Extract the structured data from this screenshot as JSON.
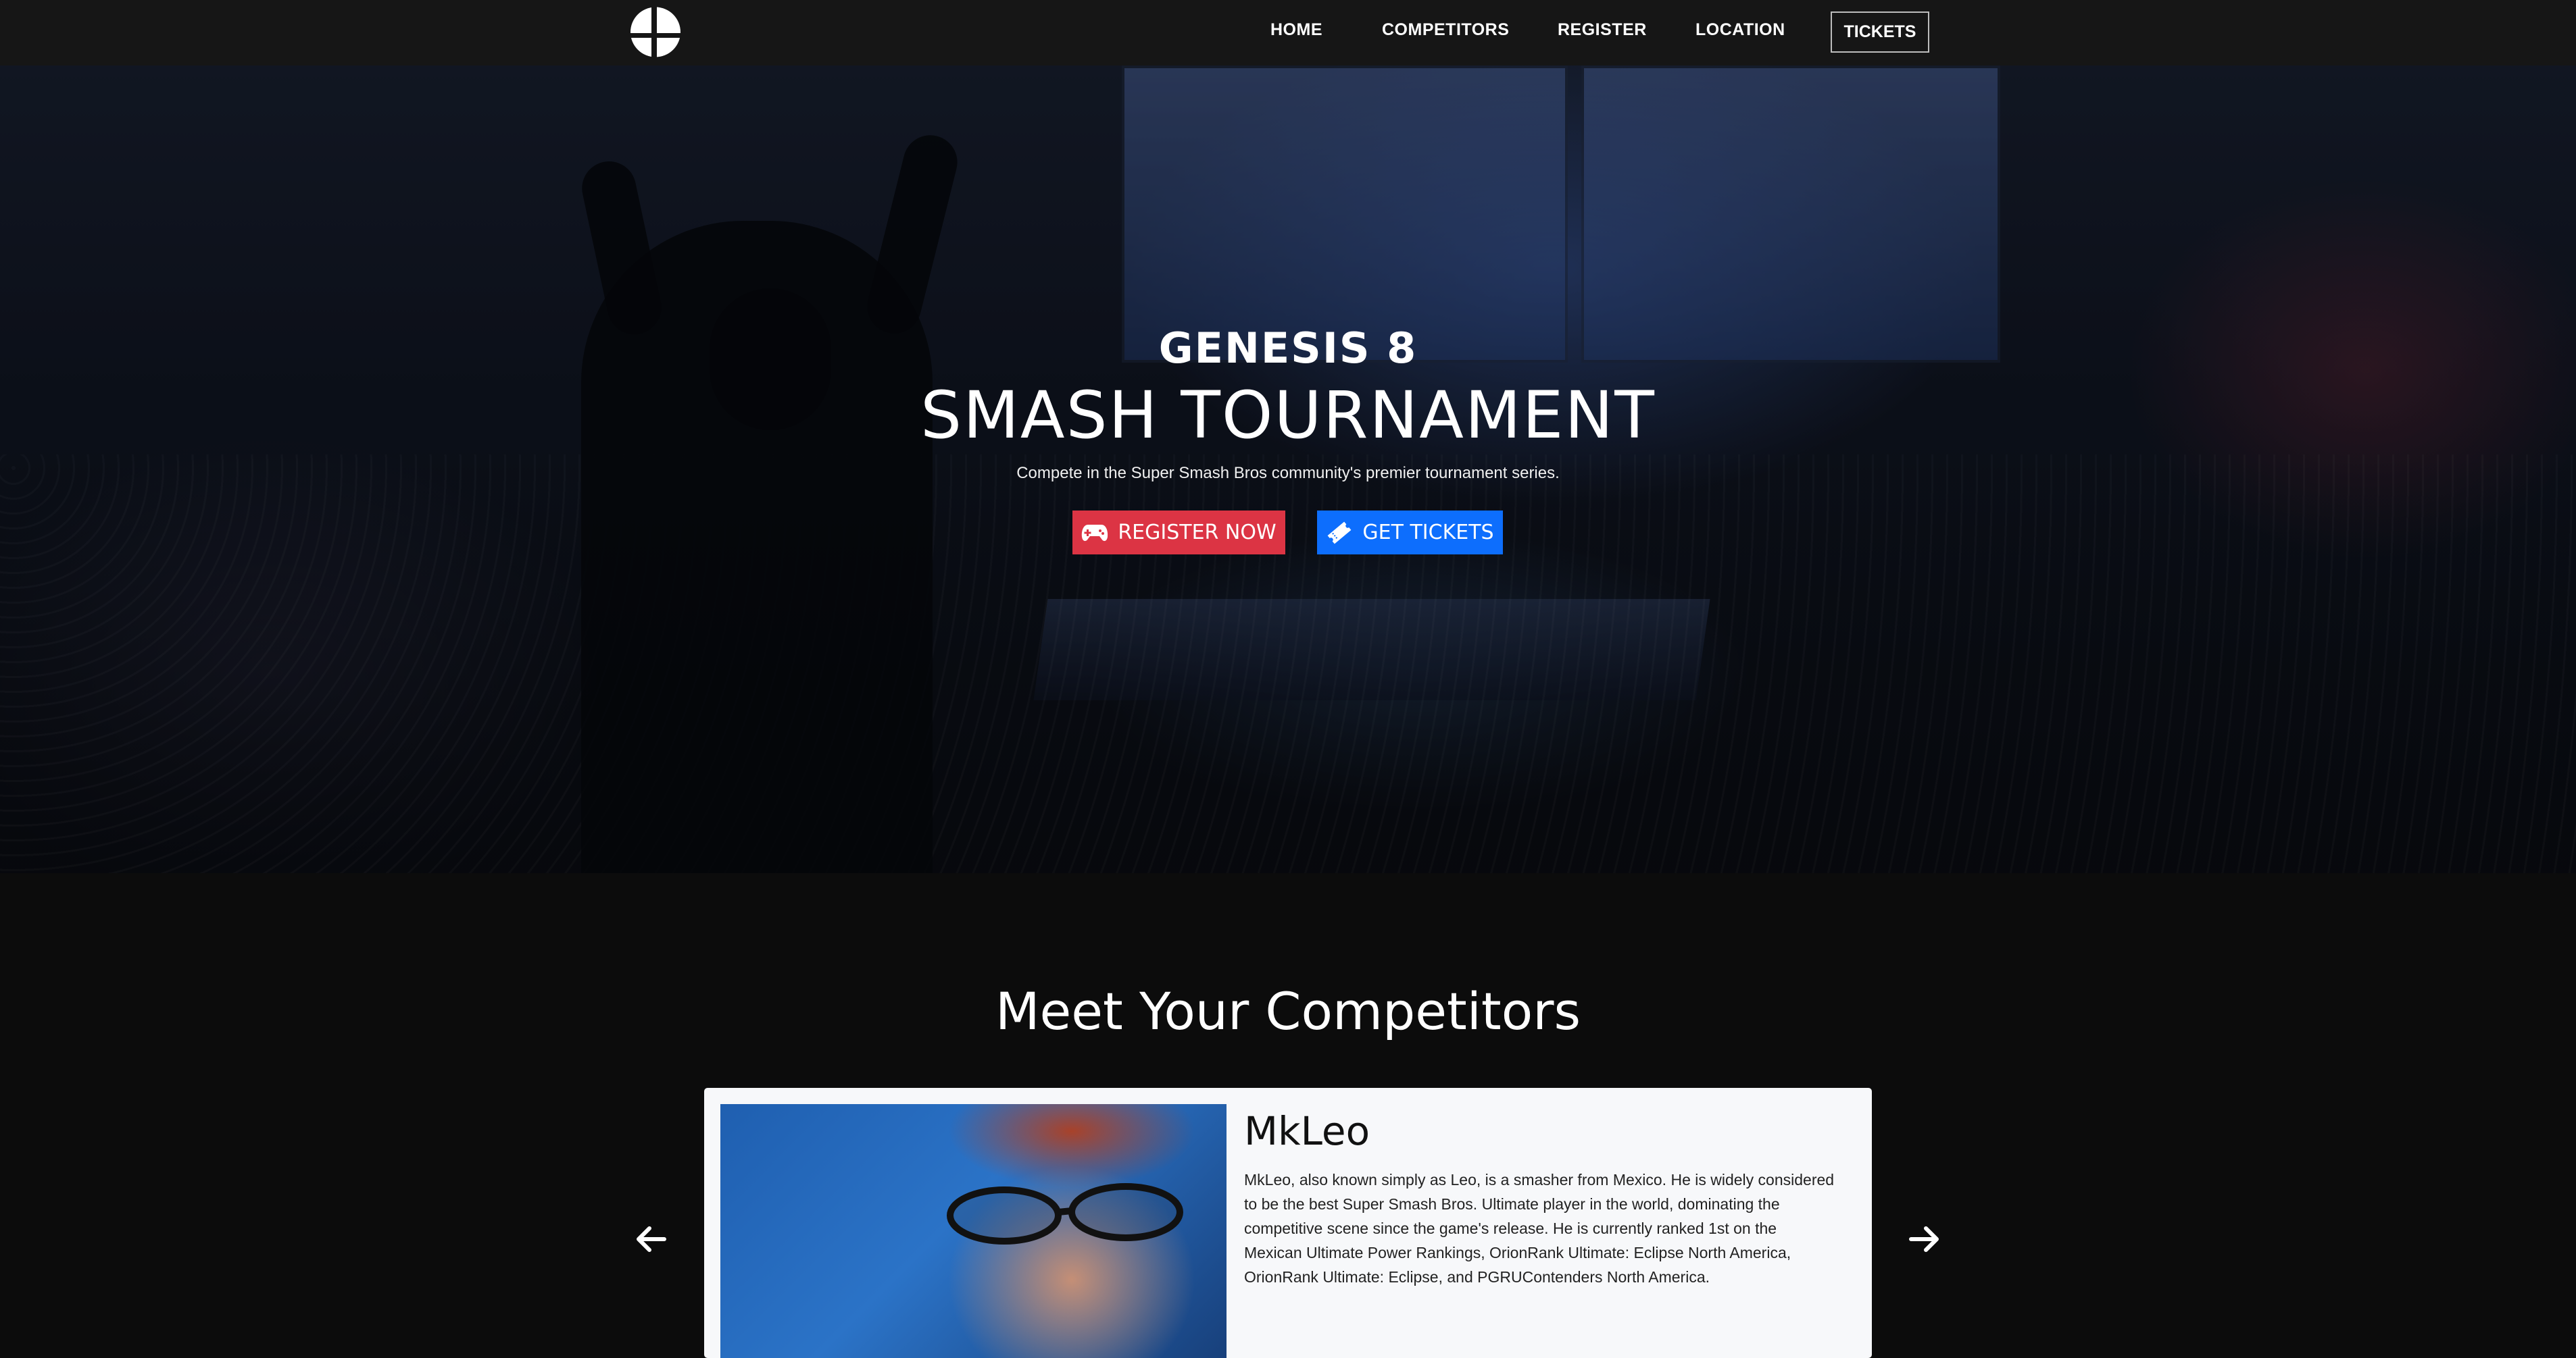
{
  "nav": {
    "links": [
      "HOME",
      "COMPETITORS",
      "REGISTER",
      "LOCATION"
    ],
    "tickets": "TICKETS",
    "logo_icon": "smash-ball-logo-icon"
  },
  "hero": {
    "subtitle": "GENESIS 8",
    "title": "SMASH TOURNAMENT",
    "tagline": "Compete in the Super Smash Bros community's premier tournament series.",
    "register_button": "REGISTER NOW",
    "register_icon": "gamepad-icon",
    "tickets_button": "GET TICKETS",
    "tickets_icon": "ticket-icon"
  },
  "competitors": {
    "title": "Meet Your Competitors",
    "card": {
      "name": "MkLeo",
      "description": "MkLeo, also known simply as Leo, is a smasher from Mexico. He is widely considered to be the best Super Smash Bros. Ultimate player in the world, dominating the competitive scene since the game's release. He is currently ranked 1st on the Mexican Ultimate Power Rankings, OrionRank Ultimate: Eclipse North America, OrionRank Ultimate: Eclipse, and PGRUContenders North America."
    },
    "prev_icon": "arrow-left-icon",
    "next_icon": "arrow-right-icon"
  },
  "colors": {
    "navbar": "#161616",
    "register": "#dc3444",
    "tickets": "#0d6efd",
    "page_bg": "#0c0c0c",
    "card_bg": "#f7f8fa"
  }
}
